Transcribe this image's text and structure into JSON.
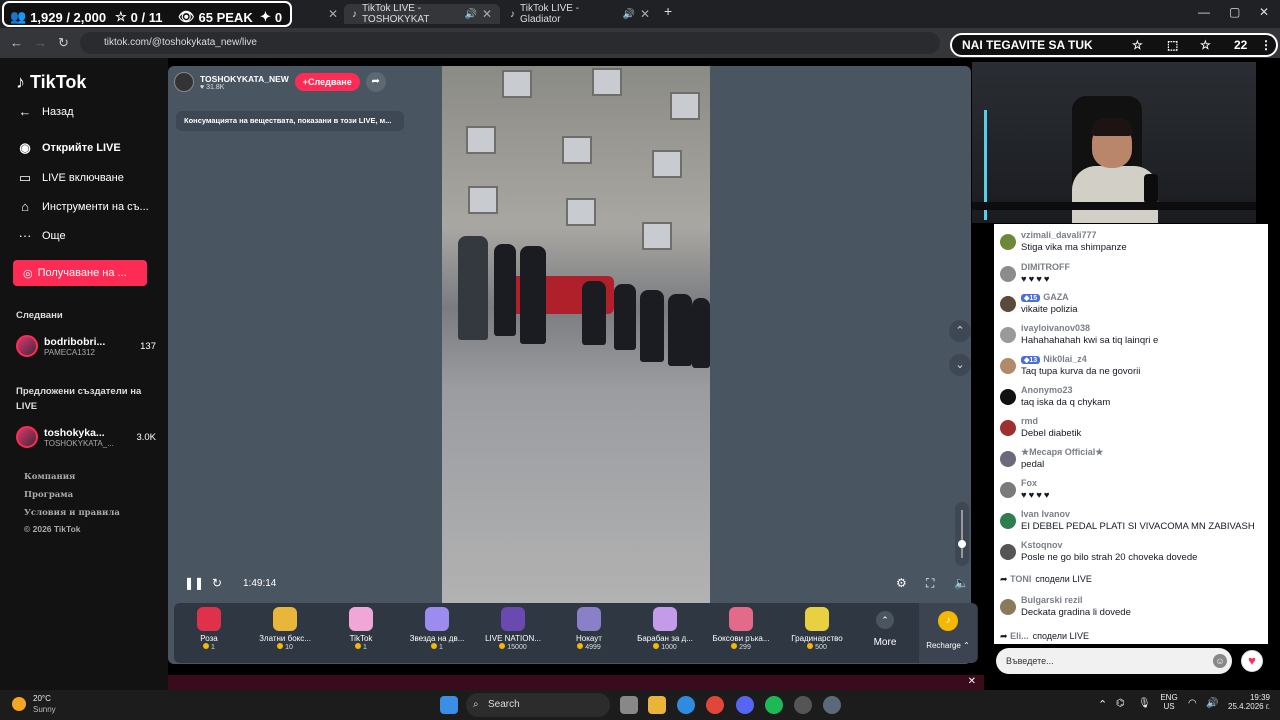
{
  "browser": {
    "stats": {
      "viewers": "1,929 / 2,000",
      "stars": "0 / 11",
      "peak": "65 PEAK",
      "users": "0"
    },
    "tabs": [
      {
        "title": "TikTok LIVE - TOSHOKYKAT"
      },
      {
        "title": "TikTok LIVE - Gladiator"
      }
    ],
    "new_tab": "+",
    "url": "tiktok.com/@toshokykata_new/live",
    "banner": "NAI TEGAVITE SA TUK",
    "profile_count": "22",
    "win_minimize": "—",
    "win_maximize": "▢",
    "win_close": "✕"
  },
  "sidebar": {
    "logo": "TikTok",
    "back": "Назад",
    "items": [
      {
        "label": "Открийте LIVE"
      },
      {
        "label": "LIVE включване"
      },
      {
        "label": "Инструменти на съ..."
      },
      {
        "label": "Още"
      }
    ],
    "cta": "Получаване на ...",
    "following_head": "Следвани",
    "following": {
      "name": "bodribobri...",
      "sub": "PAMECA1312",
      "count": "137"
    },
    "suggested_head": "Предложени създатели на LIVE",
    "suggested": {
      "name": "toshokyka...",
      "sub": "TOSHOKYKATA_...",
      "count": "3.0K"
    },
    "footer": [
      "Компания",
      "Програма",
      "Условия и правила",
      "© 2026 TikTok"
    ]
  },
  "stream": {
    "host": "TOSHOKYKATA_NEW",
    "likes": "31.8K",
    "follow": "+Следване",
    "notice": "Консумацията на веществата, показани в този LIVE, м...",
    "time": "1:49:14"
  },
  "gifts": [
    {
      "name": "Роза",
      "price": "1",
      "color": "#e0304a"
    },
    {
      "name": "Златни бокс...",
      "price": "10",
      "color": "#e8b63a"
    },
    {
      "name": "TikTok",
      "price": "1",
      "color": "#f0a7d8"
    },
    {
      "name": "Звезда на дв...",
      "price": "1",
      "color": "#9c8cf0"
    },
    {
      "name": "LIVE NATION...",
      "price": "15000",
      "color": "#6a4ab0"
    },
    {
      "name": "Нокаут",
      "price": "4999",
      "color": "#8a80c8"
    },
    {
      "name": "Барабан за д...",
      "price": "1000",
      "color": "#c49be8"
    },
    {
      "name": "Боксови ръка...",
      "price": "299",
      "color": "#e46a8a"
    },
    {
      "name": "Градинарство",
      "price": "500",
      "color": "#e8d040"
    }
  ],
  "gift_more": "More",
  "recharge": "Recharge",
  "chat": [
    {
      "user": "vzimali_davali777",
      "text": "Stiga vika ma shimpanze",
      "badge": ""
    },
    {
      "user": "DIMITROFF",
      "text": "",
      "hearts": "♥♥♥♥",
      "badge": ""
    },
    {
      "user": "GAZA",
      "text": "vikaite polizia",
      "badge": "15"
    },
    {
      "user": "ivayloivanov038",
      "text": "Hahahahahah kwi sa tiq lainqri e",
      "badge": ""
    },
    {
      "user": "Nik0lai_z4",
      "text": "Taq tupa kurva da ne govorii",
      "badge": "13"
    },
    {
      "user": "Anonymo23",
      "text": "taq iska da q chykam",
      "badge": ""
    },
    {
      "user": "rmd",
      "text": "Debel diabetik",
      "badge": ""
    },
    {
      "user": "★Месаря Official★",
      "text": "pedal",
      "badge": ""
    },
    {
      "user": "Fox",
      "text": "",
      "hearts": "♥♥♥♥",
      "badge": ""
    },
    {
      "user": "Ivan Ivanov",
      "text": "EI DEBEL PEDAL PLATI SI VIVACOMA MN ZABIVASH",
      "badge": ""
    },
    {
      "user": "Kstoqnov",
      "text": "Posle ne go bilo strah 20 choveka dovede",
      "badge": ""
    }
  ],
  "share_1": {
    "user": "TONI",
    "text": "сподели LIVE"
  },
  "chat_last": {
    "user": "Bulgarski rezil",
    "text": "Deckata gradina li dovede"
  },
  "share_2": {
    "user": "Eli...",
    "text": "сподели LIVE"
  },
  "chat_input": "Въведете...",
  "taskbar": {
    "weather_temp": "20°C",
    "weather_desc": "Sunny",
    "search": "Search",
    "lang_1": "ENG",
    "lang_2": "US",
    "time": "19:39",
    "date": "25.4.2026 г."
  }
}
